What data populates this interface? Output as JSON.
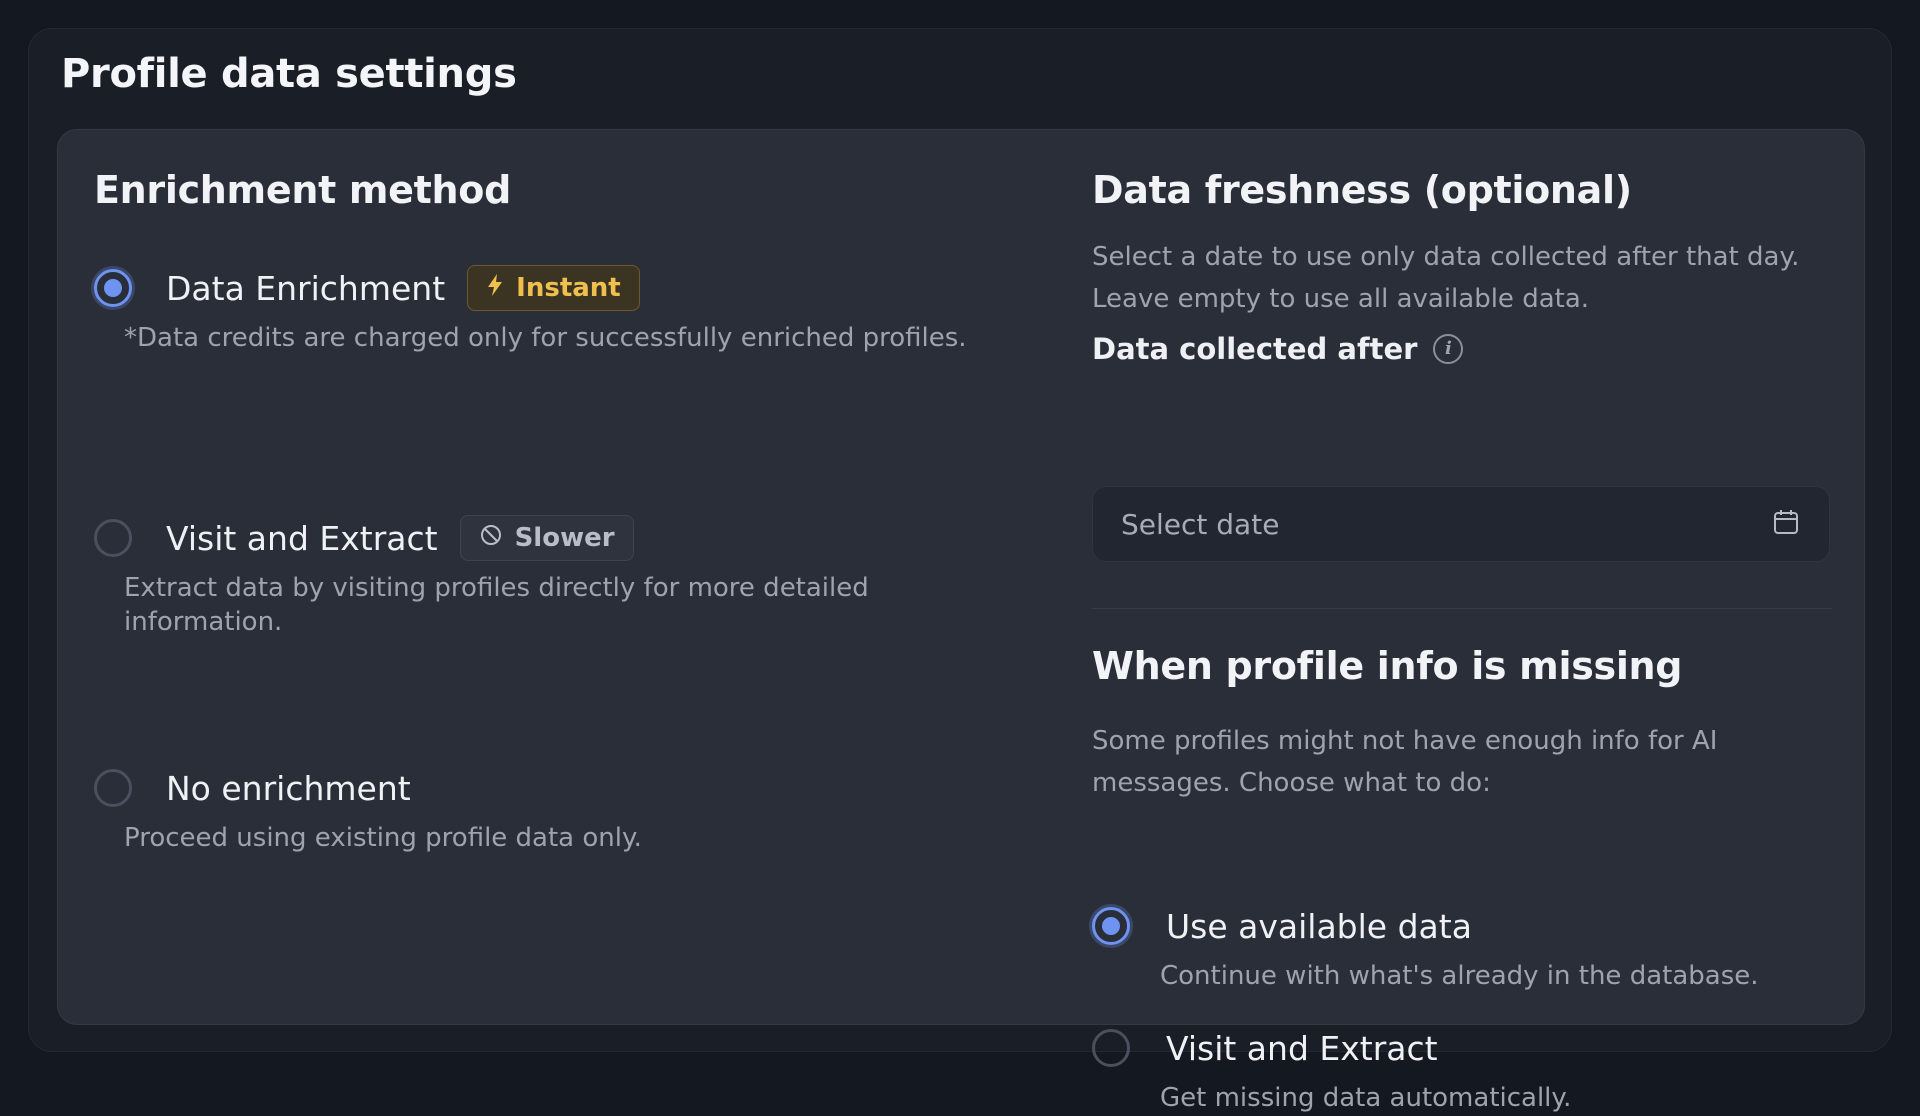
{
  "page": {
    "title": "Profile data settings"
  },
  "enrichment": {
    "heading": "Enrichment method",
    "options": [
      {
        "label": "Data Enrichment",
        "badge": {
          "label": "Instant",
          "icon": "lightning-icon"
        },
        "description": "*Data credits are charged only for successfully enriched profiles.",
        "selected": true
      },
      {
        "label": "Visit and Extract",
        "badge": {
          "label": "Slower",
          "icon": "slow-circle-icon"
        },
        "description": "Extract data by visiting profiles directly for more detailed information.",
        "selected": false
      },
      {
        "label": "No enrichment",
        "description": "Proceed using existing profile data only.",
        "selected": false
      }
    ]
  },
  "freshness": {
    "heading": "Data freshness (optional)",
    "help_line1": "Select a date to use only data collected after that day.",
    "help_line2": "Leave empty to use all available data.",
    "field_label": "Data collected after",
    "info_icon": "i",
    "date_placeholder": "Select date"
  },
  "missing": {
    "heading": "When profile info is missing",
    "help_line1": "Some profiles might not have enough info for AI",
    "help_line2": "messages. Choose what to do:",
    "options": [
      {
        "label": "Use available data",
        "description": "Continue with what's already in the database.",
        "selected": true
      },
      {
        "label": "Visit and Extract",
        "description": "Get missing data automatically.",
        "selected": false
      }
    ]
  },
  "colors": {
    "accent": "#6e93f0",
    "instant_badge": "#f0c04e",
    "panel_bg": "#2a2e39",
    "page_bg": "#141821"
  }
}
